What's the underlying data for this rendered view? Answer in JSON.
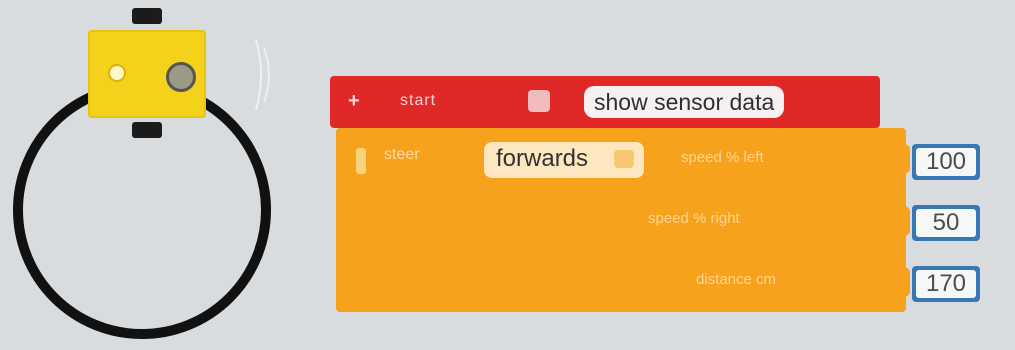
{
  "workspace": {
    "robot": {
      "name": "",
      "colors": {
        "body": "#f4d21b",
        "track": "#111111",
        "background": "#d8dcdf"
      }
    }
  },
  "blocks": {
    "event": {
      "title": "start",
      "routine_name": "show sensor data",
      "color": "#e02828"
    },
    "drive": {
      "title": "steer",
      "direction": "forwards",
      "params": [
        {
          "label": "speed % left",
          "value": "100"
        },
        {
          "label": "speed % right",
          "value": "50"
        },
        {
          "label": "distance cm",
          "value": "170"
        }
      ],
      "color": "#f7a21c",
      "input_color": "#3677b4"
    }
  }
}
